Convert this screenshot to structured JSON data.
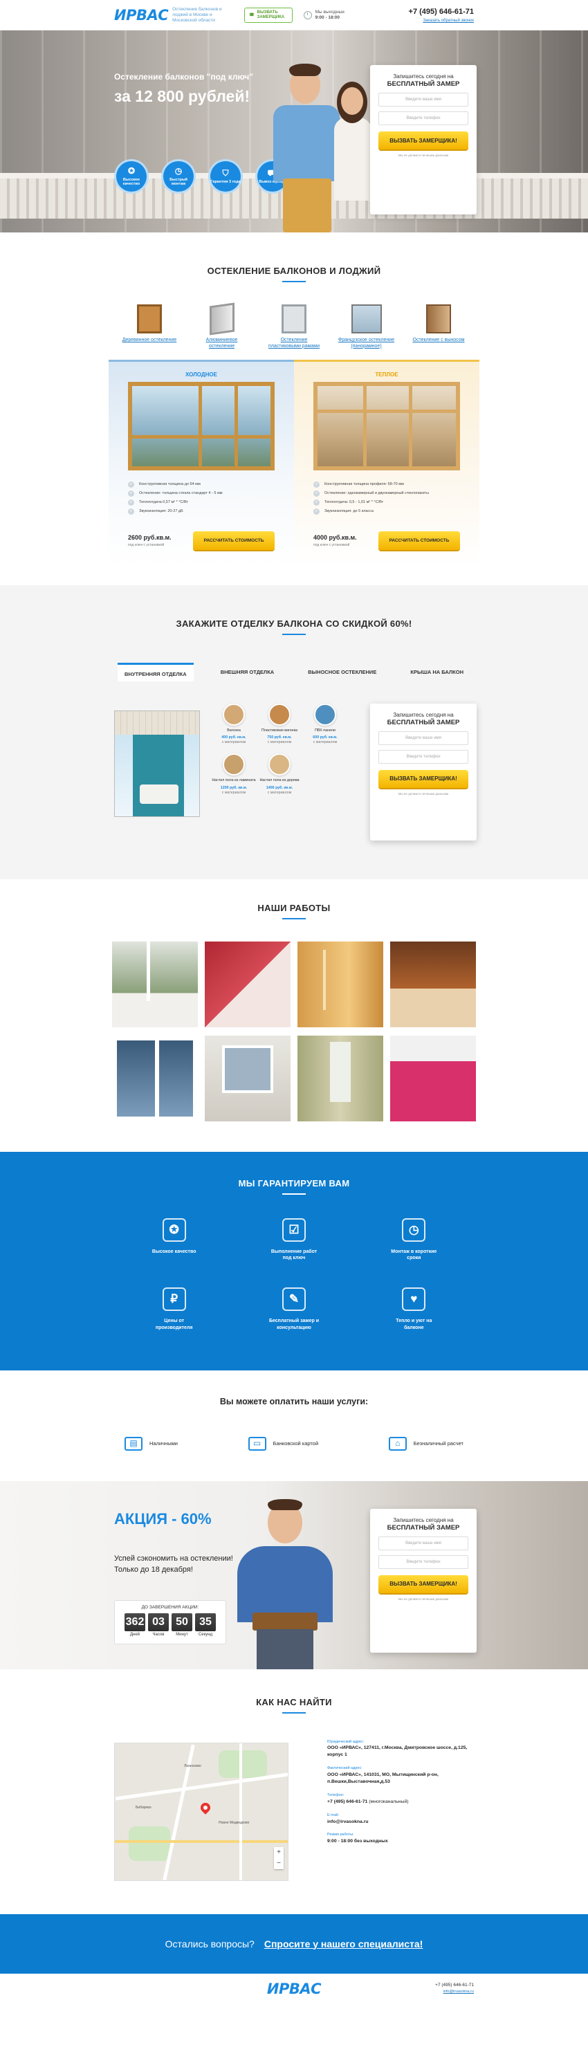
{
  "header": {
    "logo": "ИРВАС",
    "tagline": "Остекление балконов и лоджий в Москве и Московской области",
    "call_button": "Вызвать замерщика",
    "hours_label": "Мы выходные",
    "hours": "9:00 - 18:00",
    "phone": "+7 (495) 646-61-71",
    "callback_link": "Заказать обратный звонок"
  },
  "hero": {
    "subtitle": "Остекление балконов \"под ключ\"",
    "price_title": "за 12 800 рублей!",
    "badges": [
      {
        "label": "Высокое качество",
        "icon": "medal-icon"
      },
      {
        "label": "Быстрый монтаж",
        "icon": "clock-icon"
      },
      {
        "label": "Гарантия 3 года",
        "icon": "shield-icon"
      },
      {
        "label": "Вывоз мусора",
        "icon": "truck-icon"
      }
    ],
    "form": {
      "title_line1": "Запишитесь сегодня на",
      "title_line2": "БЕСПЛАТНЫЙ ЗАМЕР",
      "name_placeholder": "Введите ваше имя",
      "phone_placeholder": "Введите телефон",
      "button": "ВЫЗВАТЬ ЗАМЕРЩИКА!",
      "note": "Мы не делимся личными данными"
    }
  },
  "glazing": {
    "title": "ОСТЕКЛЕНИЕ БАЛКОНОВ И ЛОДЖИЙ",
    "types": [
      {
        "label": "Деревянное остекление",
        "icon": "wood-frame-icon"
      },
      {
        "label": "Алюминиевое остекление",
        "icon": "aluminum-frame-icon"
      },
      {
        "label": "Остекление пластиковыми рамами",
        "icon": "plastic-frame-icon"
      },
      {
        "label": "Французское остекление (панорамное)",
        "icon": "panoramic-window-icon"
      },
      {
        "label": "Остекление с выносом",
        "icon": "extended-window-icon"
      }
    ],
    "cold": {
      "head": "ХОЛОДНОЕ",
      "features": [
        "Конструктивная толщина до 64 мм",
        "Остекление: толщина стекла стандарт 4 - 5 мм",
        "Теплоотдача 0,57 м² * °С/Вт",
        "Звукоизоляция: 20-27 дБ"
      ],
      "price": "2600 руб.кв.м.",
      "price_sub": "под ключ с установкой",
      "button": "РАССЧИТАТЬ СТОИМОСТЬ"
    },
    "warm": {
      "head": "ТЕПЛОЕ",
      "features": [
        "Конструктивная толщина профиля: 58-70 мм",
        "Остекление: однокамерный и двухкамерный стеклопакеты",
        "Теплоотдача: 0,5 - 1,01 м² * °С/Вт",
        "Звукоизоляция: до 5 класса"
      ],
      "price": "4000 руб.кв.м.",
      "price_sub": "под ключ с установкой",
      "button": "РАССЧИТАТЬ СТОИМОСТЬ"
    }
  },
  "finish": {
    "title": "ЗАКАЖИТЕ ОТДЕЛКУ БАЛКОНА СО СКИДКОЙ 60%!",
    "tabs": [
      "ВНУТРЕННЯЯ ОТДЕЛКА",
      "ВНЕШНЯЯ ОТДЕЛКА",
      "ВЫНОСНОЕ ОСТЕКЛЕНИЕ",
      "КРЫША НА БАЛКОН"
    ],
    "materials": [
      {
        "name": "Вагонка",
        "price": "400 руб. кв.м.",
        "price_sub": "с материалом",
        "color": "#d2a874"
      },
      {
        "name": "Пластиковая вагонка",
        "price": "750 руб. кв.м.",
        "price_sub": "с материалом",
        "color": "#c58a4c"
      },
      {
        "name": "ПВХ панели",
        "price": "600 руб. кв.м.",
        "price_sub": "с материалом",
        "color": "#4f8fc0"
      },
      {
        "name": "Настил пола из ламината",
        "price": "1200 руб. кв.м.",
        "price_sub": "с материалом",
        "color": "#c8a06c"
      },
      {
        "name": "Настил пола из дерева",
        "price": "1400 руб. кв.м.",
        "price_sub": "с материалом",
        "color": "#d9b684"
      }
    ],
    "form": {
      "title_line1": "Запишитесь сегодня на",
      "title_line2": "БЕСПЛАТНЫЙ ЗАМЕР",
      "name_placeholder": "Введите ваше имя",
      "phone_placeholder": "Введите телефон",
      "button": "ВЫЗВАТЬ ЗАМЕРЩИКА!",
      "note": "Мы не делимся личными данными"
    }
  },
  "works": {
    "title": "НАШИ РАБОТЫ"
  },
  "guarantee": {
    "title": "МЫ ГАРАНТИРУЕМ ВАМ",
    "items": [
      {
        "label": "Высокое качество",
        "icon": "quality-medal-icon",
        "glyph": "✪"
      },
      {
        "label": "Выполнение работ под ключ",
        "icon": "clipboard-icon",
        "glyph": "☑"
      },
      {
        "label": "Монтаж в короткие сроки",
        "icon": "stopwatch-icon",
        "glyph": "◷"
      },
      {
        "label": "Цены от производителя",
        "icon": "piggy-bank-icon",
        "glyph": "₽"
      },
      {
        "label": "Бесплатный замер и консультацию",
        "icon": "ruler-icon",
        "glyph": "✎"
      },
      {
        "label": "Тепло и уют на балконе",
        "icon": "heart-hand-icon",
        "glyph": "♥"
      }
    ]
  },
  "payment": {
    "title": "Вы можете оплатить наши услуги:",
    "methods": [
      {
        "label": "Наличными",
        "icon": "wallet-icon",
        "glyph": "▤"
      },
      {
        "label": "Банковской картой",
        "icon": "card-icon",
        "glyph": "▭"
      },
      {
        "label": "Безналичный расчет",
        "icon": "bank-icon",
        "glyph": "⌂"
      }
    ]
  },
  "promo": {
    "title": "АКЦИЯ - 60%",
    "text1": "Успей сэкономить на остеклении!",
    "text2": "Только до 18 декабря!",
    "timer_label": "ДО ЗАВЕРШЕНИЯ АКЦИИ:",
    "timer": [
      {
        "value": "362",
        "unit": "Дней"
      },
      {
        "value": "03",
        "unit": "Часов"
      },
      {
        "value": "50",
        "unit": "Минут"
      },
      {
        "value": "35",
        "unit": "Секунд"
      }
    ],
    "form": {
      "title_line1": "Запишитесь сегодня на",
      "title_line2": "БЕСПЛАТНЫЙ ЗАМЕР",
      "name_placeholder": "Введите ваше имя",
      "phone_placeholder": "Введите телефон",
      "button": "ВЫЗВАТЬ ЗАМЕРЩИКА!",
      "note": "Мы не делимся личными данными"
    }
  },
  "contacts": {
    "title": "КАК НАС НАЙТИ",
    "legal_label": "Юридический адрес:",
    "legal": "ООО «ИРВАС», 127411, г.Москва, Дмитровское шоссе, д.125, корпус 1",
    "actual_label": "Фактический адрес:",
    "actual": "ООО «ИРВАС», 141031, МО, Мытищинский р-он, п.Вешки,Выставочная,д.53",
    "phone_label": "Телефон:",
    "phone": "+7 (495) 646-61-71",
    "phone_note": "(многоканальный)",
    "email_label": "E-mail:",
    "email": "info@irvasokna.ru",
    "hours_label": "Режим работы:",
    "hours": "9:00 - 18:00 без выходных",
    "map_labels": [
      "Лианозово",
      "Новое Медведково",
      "Бибирево"
    ]
  },
  "cta": {
    "text": "Остались вопросы?",
    "link": "Спросите у нашего специалиста!"
  },
  "footer": {
    "logo": "ИРВАС",
    "phone": "+7 (495) 646-61-71",
    "email": "info@irvasokna.ru"
  }
}
